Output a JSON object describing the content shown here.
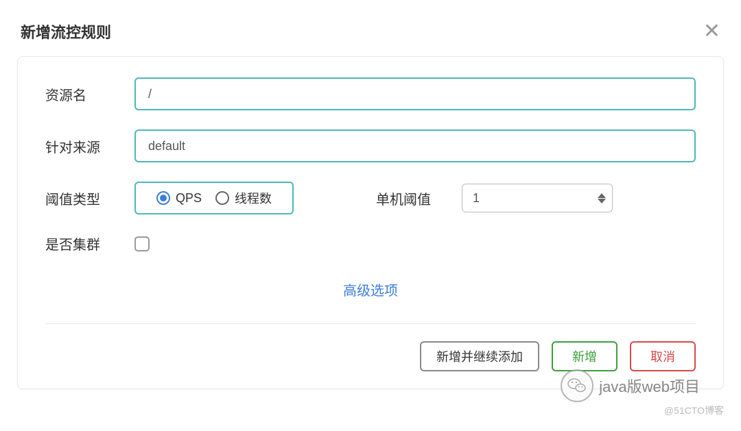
{
  "modal": {
    "title": "新增流控规则",
    "close": "✕"
  },
  "form": {
    "resourceName": {
      "label": "资源名",
      "value": "/"
    },
    "source": {
      "label": "针对来源",
      "value": "default"
    },
    "thresholdType": {
      "label": "阈值类型",
      "options": {
        "qps": "QPS",
        "threads": "线程数"
      }
    },
    "singleThreshold": {
      "label": "单机阈值",
      "value": "1"
    },
    "cluster": {
      "label": "是否集群"
    },
    "advanced": "高级选项"
  },
  "footer": {
    "addContinue": "新增并继续添加",
    "add": "新增",
    "cancel": "取消"
  },
  "overlay": {
    "wechat": "java版web项目",
    "source": "@51CTO博客"
  }
}
